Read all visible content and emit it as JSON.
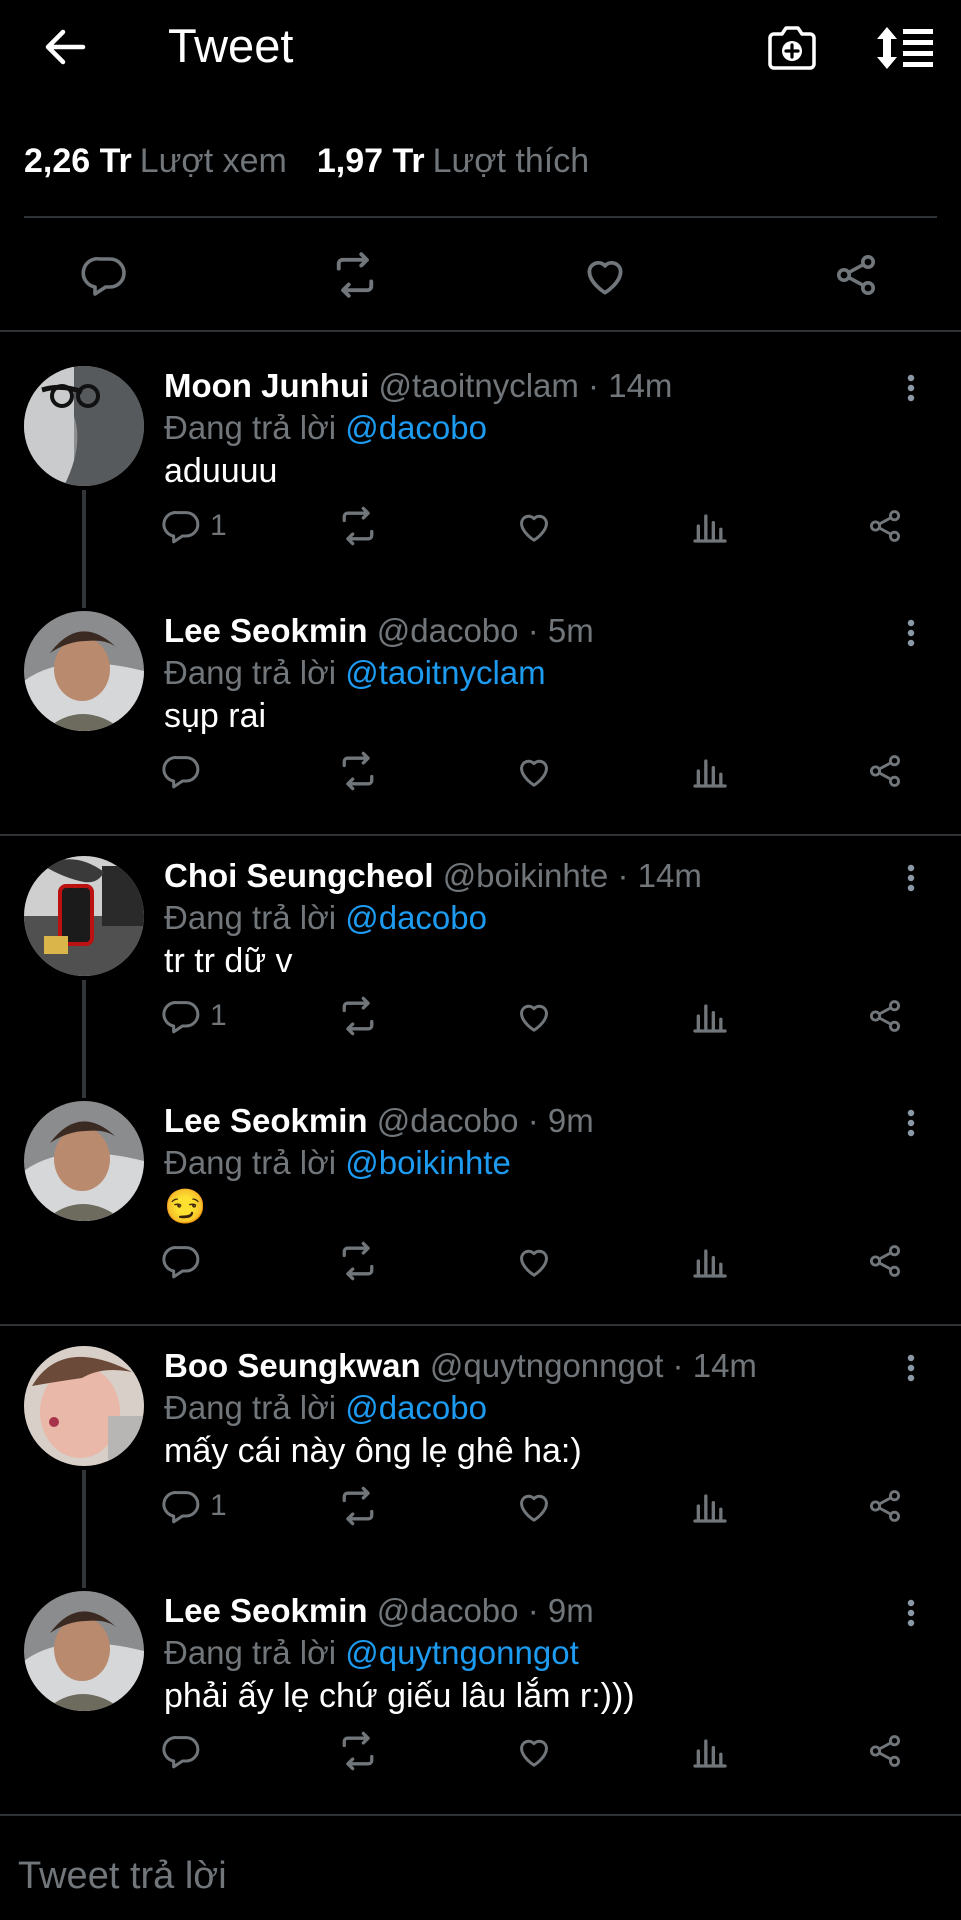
{
  "header": {
    "title": "Tweet"
  },
  "stats": {
    "views_value": "2,26 Tr",
    "views_label": "Lượt xem",
    "likes_value": "1,97 Tr",
    "likes_label": "Lượt thích"
  },
  "replies": [
    {
      "name": "Moon Junhui",
      "handle": "@taoitnyclam",
      "dot": "·",
      "time": "14m",
      "replying_label": "Đang trả lời",
      "mention": "@dacobo",
      "text": "aduuuu",
      "reply_count": "1"
    },
    {
      "name": "Lee Seokmin",
      "handle": "@dacobo",
      "dot": "·",
      "time": "5m",
      "replying_label": "Đang trả lời",
      "mention": "@taoitnyclam",
      "text": "sụp rai",
      "reply_count": ""
    },
    {
      "name": "Choi Seungcheol",
      "handle": "@boikinhte",
      "dot": "·",
      "time": "14m",
      "replying_label": "Đang trả lời",
      "mention": "@dacobo",
      "text": "tr tr dữ v",
      "reply_count": "1"
    },
    {
      "name": "Lee Seokmin",
      "handle": "@dacobo",
      "dot": "·",
      "time": "9m",
      "replying_label": "Đang trả lời",
      "mention": "@boikinhte",
      "text": "😏",
      "reply_count": ""
    },
    {
      "name": "Boo Seungkwan",
      "handle": "@quytngonngot",
      "dot": "·",
      "time": "14m",
      "replying_label": "Đang trả lời",
      "mention": "@dacobo",
      "text": "mấy cái này ông lẹ ghê ha:)",
      "reply_count": "1"
    },
    {
      "name": "Lee Seokmin",
      "handle": "@dacobo",
      "dot": "·",
      "time": "9m",
      "replying_label": "Đang trả lời",
      "mention": "@quytngonngot",
      "text": "phải ấy lẹ chứ giếu lâu lắm r:)))",
      "reply_count": ""
    }
  ],
  "compose": {
    "placeholder": "Tweet trả lời"
  },
  "colors": {
    "background": "#000000",
    "muted": "#71767b",
    "link": "#1d9bf0",
    "divider": "#2f3336"
  }
}
